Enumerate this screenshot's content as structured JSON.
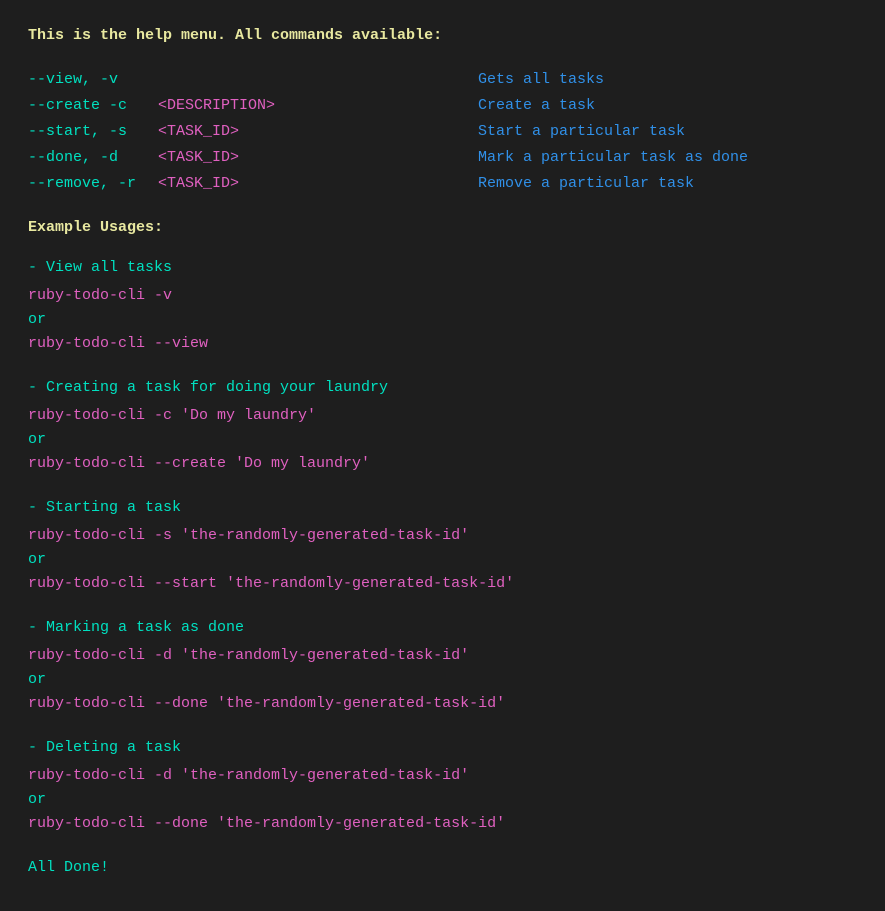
{
  "header": {
    "title": "This is the help menu. All commands available:"
  },
  "commands": [
    {
      "flag": "--view, -v",
      "arg": "",
      "description": "Gets all tasks"
    },
    {
      "flag": "--create -c",
      "arg": "<DESCRIPTION>",
      "description": "Create a task"
    },
    {
      "flag": "--start, -s",
      "arg": "<TASK_ID>",
      "description": "Start a particular task"
    },
    {
      "flag": "--done, -d",
      "arg": "<TASK_ID>",
      "description": "Mark a particular task as done"
    },
    {
      "flag": "--remove, -r",
      "arg": "<TASK_ID>",
      "description": "Remove a particular task"
    }
  ],
  "examples_header": "Example Usages:",
  "examples": [
    {
      "title": "- View all tasks",
      "lines": [
        "ruby-todo-cli -v",
        "or",
        "ruby-todo-cli --view"
      ]
    },
    {
      "title": "- Creating a task for doing your laundry",
      "lines": [
        "ruby-todo-cli -c 'Do my laundry'",
        "or",
        "ruby-todo-cli --create 'Do my laundry'"
      ]
    },
    {
      "title": "- Starting a task",
      "lines": [
        "ruby-todo-cli -s 'the-randomly-generated-task-id'",
        "or",
        "ruby-todo-cli --start 'the-randomly-generated-task-id'"
      ]
    },
    {
      "title": "- Marking a task as done",
      "lines": [
        "ruby-todo-cli -d 'the-randomly-generated-task-id'",
        "or",
        "ruby-todo-cli --done 'the-randomly-generated-task-id'"
      ]
    },
    {
      "title": "- Deleting a task",
      "lines": [
        "ruby-todo-cli -d 'the-randomly-generated-task-id'",
        "or",
        "ruby-todo-cli --done 'the-randomly-generated-task-id'"
      ]
    }
  ],
  "all_done": "All Done!"
}
